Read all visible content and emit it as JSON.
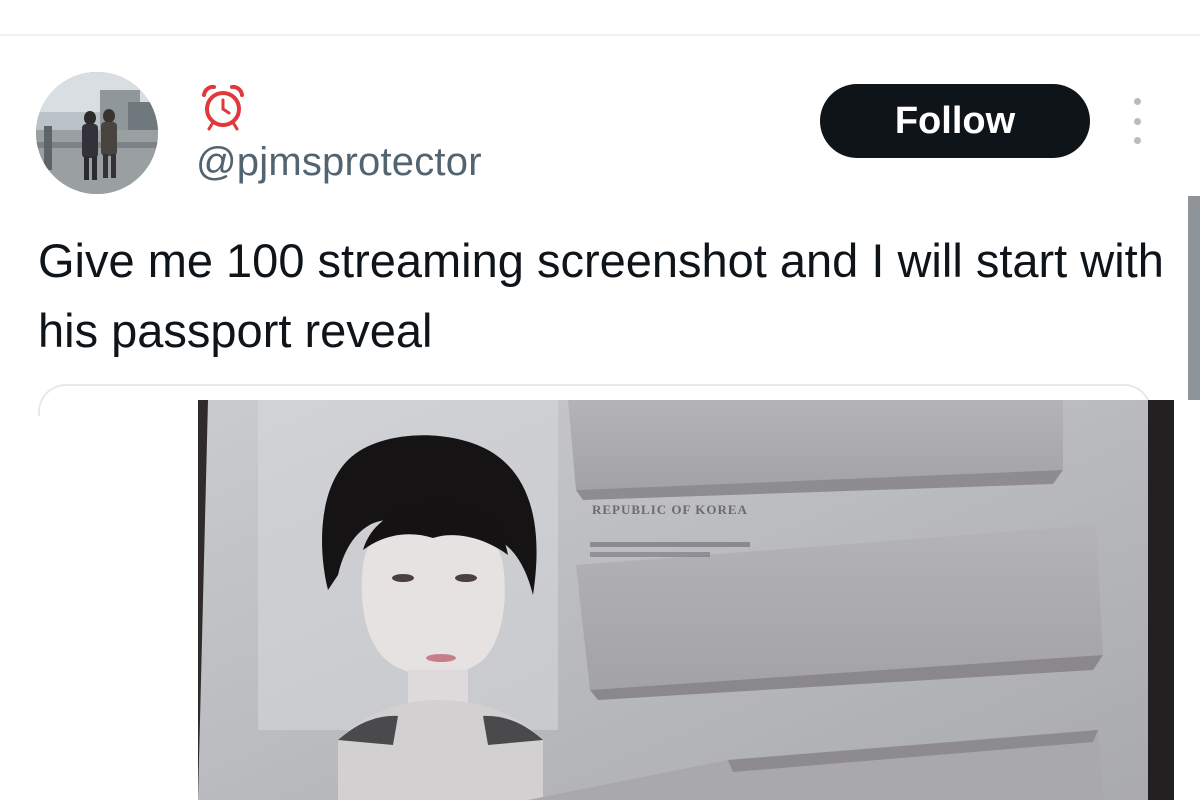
{
  "tweet": {
    "handle": "@pjmsprotector",
    "follow_label": "Follow",
    "text": "Give me 100 streaming screenshot and I will start with his passport reveal"
  },
  "media": {
    "passport_text": "REPUBLIC OF KOREA"
  },
  "icons": {
    "badge": "alarm-clock-icon",
    "more": "more-vertical-icon"
  },
  "colors": {
    "follow_bg": "#0f1419",
    "follow_text": "#ffffff",
    "handle": "#536471",
    "text": "#0f1419",
    "alarm_red": "#e0383b"
  }
}
